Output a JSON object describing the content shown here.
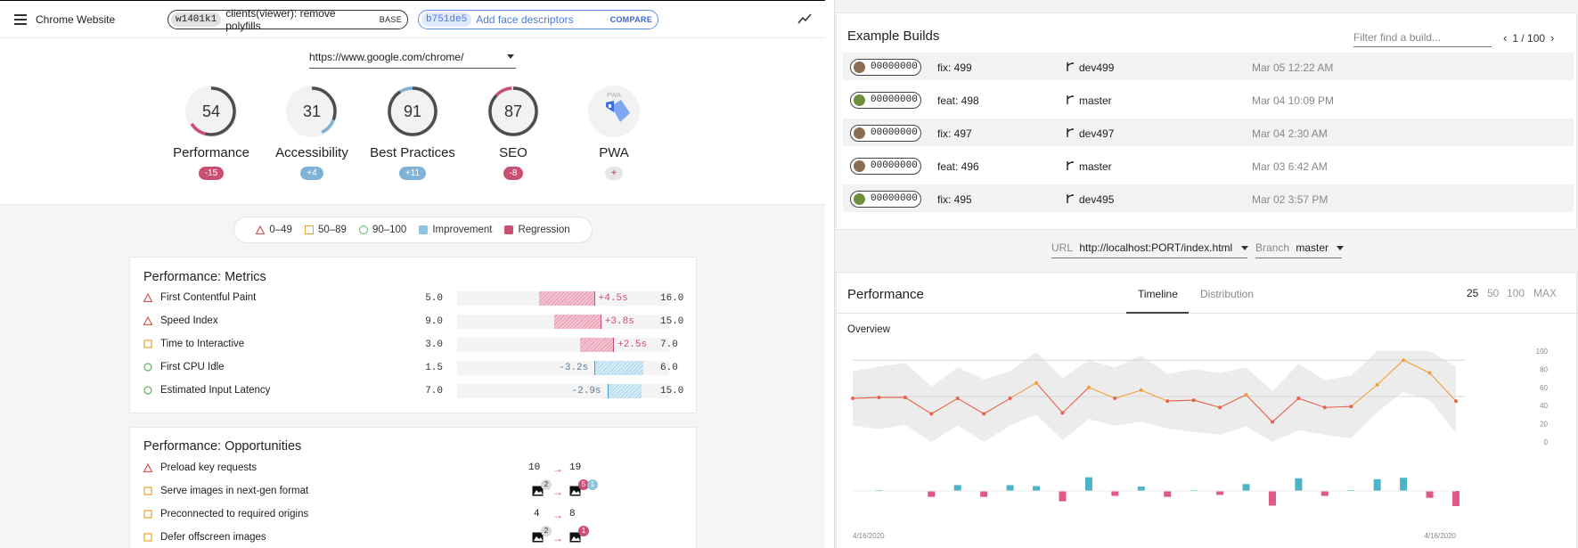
{
  "app": {
    "title": "Chrome Website",
    "base": {
      "hash": "w1401k1",
      "message": "clients(viewer): remove polyfills",
      "tag": "BASE"
    },
    "compare": {
      "hash": "b751de5",
      "message": "Add face descriptors",
      "tag": "COMPARE"
    },
    "url": "https://www.google.com/chrome/"
  },
  "gauges": [
    {
      "label": "Performance",
      "score": "54",
      "delta": "-15",
      "fill": 0.54,
      "color": "#c94f73",
      "kind": "bad"
    },
    {
      "label": "Accessibility",
      "score": "31",
      "delta": "+4",
      "fill": 0.31,
      "color": "#7fb2d6",
      "kind": "good"
    },
    {
      "label": "Best Practices",
      "score": "91",
      "delta": "+11",
      "fill": 0.91,
      "color": "#7fb2d6",
      "kind": "good"
    },
    {
      "label": "SEO",
      "score": "87",
      "delta": "-8",
      "fill": 0.87,
      "color": "#c94f73",
      "kind": "bad"
    },
    {
      "label": "PWA",
      "score": "",
      "delta": "+",
      "fill": 0,
      "color": "#5b8def",
      "kind": "neutral"
    }
  ],
  "legend": {
    "poor": "0–49",
    "average": "50–89",
    "good": "90–100",
    "improvement": "Improvement",
    "regression": "Regression"
  },
  "metrics": {
    "title": "Performance: Metrics",
    "rows": [
      {
        "name": "First Contentful Paint",
        "lo": "5.0",
        "hi": "16.0",
        "delta": "+4.5s",
        "rating": "poor",
        "kind": "regr",
        "from": 0.64,
        "to": 0.86
      },
      {
        "name": "Speed Index",
        "lo": "9.0",
        "hi": "15.0",
        "delta": "+3.8s",
        "rating": "poor",
        "kind": "regr",
        "from": 0.71,
        "to": 0.89
      },
      {
        "name": "Time to Interactive",
        "lo": "3.0",
        "hi": "7.0",
        "delta": "+2.5s",
        "rating": "average",
        "kind": "regr",
        "from": 0.83,
        "to": 0.95
      },
      {
        "name": "First CPU Idle",
        "lo": "1.5",
        "hi": "6.0",
        "delta": "-3.2s",
        "rating": "good",
        "kind": "impr",
        "from": 0.81,
        "to": 1.0
      },
      {
        "name": "Estimated Input Latency",
        "lo": "7.0",
        "hi": "15.0",
        "delta": "-2.9s",
        "rating": "good",
        "kind": "impr",
        "from": 0.87,
        "to": 0.99
      }
    ]
  },
  "opportunities": {
    "title": "Performance: Opportunities",
    "rows": [
      {
        "name": "Preload key requests",
        "rating": "poor",
        "from": "10",
        "to": "19"
      },
      {
        "name": "Serve images in next-gen format",
        "rating": "average",
        "from_badge": "2",
        "to_badge": "5",
        "to_badge2": "1"
      },
      {
        "name": "Preconnected to required origins",
        "rating": "average",
        "from": "4",
        "to": "8"
      },
      {
        "name": "Defer offscreen images",
        "rating": "average",
        "from_badge": "2",
        "to_badge": "1"
      }
    ]
  },
  "builds": {
    "title": "Example Builds",
    "filter_placeholder": "Filter find a build...",
    "pager": "1 / 100",
    "rows": [
      {
        "hash": "00000000",
        "msg": "fix: 499",
        "branch": "dev499",
        "time": "Mar 05 12:22 AM",
        "avatar": "#8a6d52"
      },
      {
        "hash": "00000000",
        "msg": "feat: 498",
        "branch": "master",
        "time": "Mar 04 10:09 PM",
        "avatar": "#6f8f3f"
      },
      {
        "hash": "00000000",
        "msg": "fix: 497",
        "branch": "dev497",
        "time": "Mar 04 2:30 AM",
        "avatar": "#8a6d52"
      },
      {
        "hash": "00000000",
        "msg": "feat: 496",
        "branch": "master",
        "time": "Mar 03 6:42 AM",
        "avatar": "#8a6d52"
      },
      {
        "hash": "00000000",
        "msg": "fix: 495",
        "branch": "dev495",
        "time": "Mar 02 3:57 PM",
        "avatar": "#6f8f3f"
      }
    ]
  },
  "selectors": {
    "url_label": "URL",
    "url_value": "http://localhost:PORT/index.html",
    "branch_label": "Branch",
    "branch_value": "master"
  },
  "perf_panel": {
    "title": "Performance",
    "tabs": [
      "Timeline",
      "Distribution"
    ],
    "ranges": [
      "25",
      "50",
      "100",
      "MAX"
    ],
    "overview_label": "Overview"
  },
  "chart_data": {
    "type": "line",
    "ylim": [
      0,
      100
    ],
    "y_ticks": [
      "100",
      "80",
      "60",
      "40",
      "20",
      "0"
    ],
    "x_start_label": "4/16/2020",
    "x_end_label": "4/16/2020",
    "scores": [
      48,
      49,
      49,
      31,
      48,
      31,
      48,
      65,
      32,
      60,
      48,
      57,
      45,
      46,
      38,
      52,
      22,
      48,
      38,
      39,
      63,
      90,
      76,
      45
    ],
    "deltas": [
      0,
      1,
      0,
      -12,
      12,
      -12,
      12,
      10,
      -21,
      28,
      -10,
      9,
      -12,
      1,
      -8,
      14,
      -30,
      26,
      -10,
      1,
      24,
      27,
      -14,
      -31
    ],
    "colors": {
      "poor": "#e8624a",
      "average": "#f0a03a",
      "pos_bar": "#4bb4c9",
      "neg_bar": "#e05888",
      "band": "#ececec"
    }
  }
}
